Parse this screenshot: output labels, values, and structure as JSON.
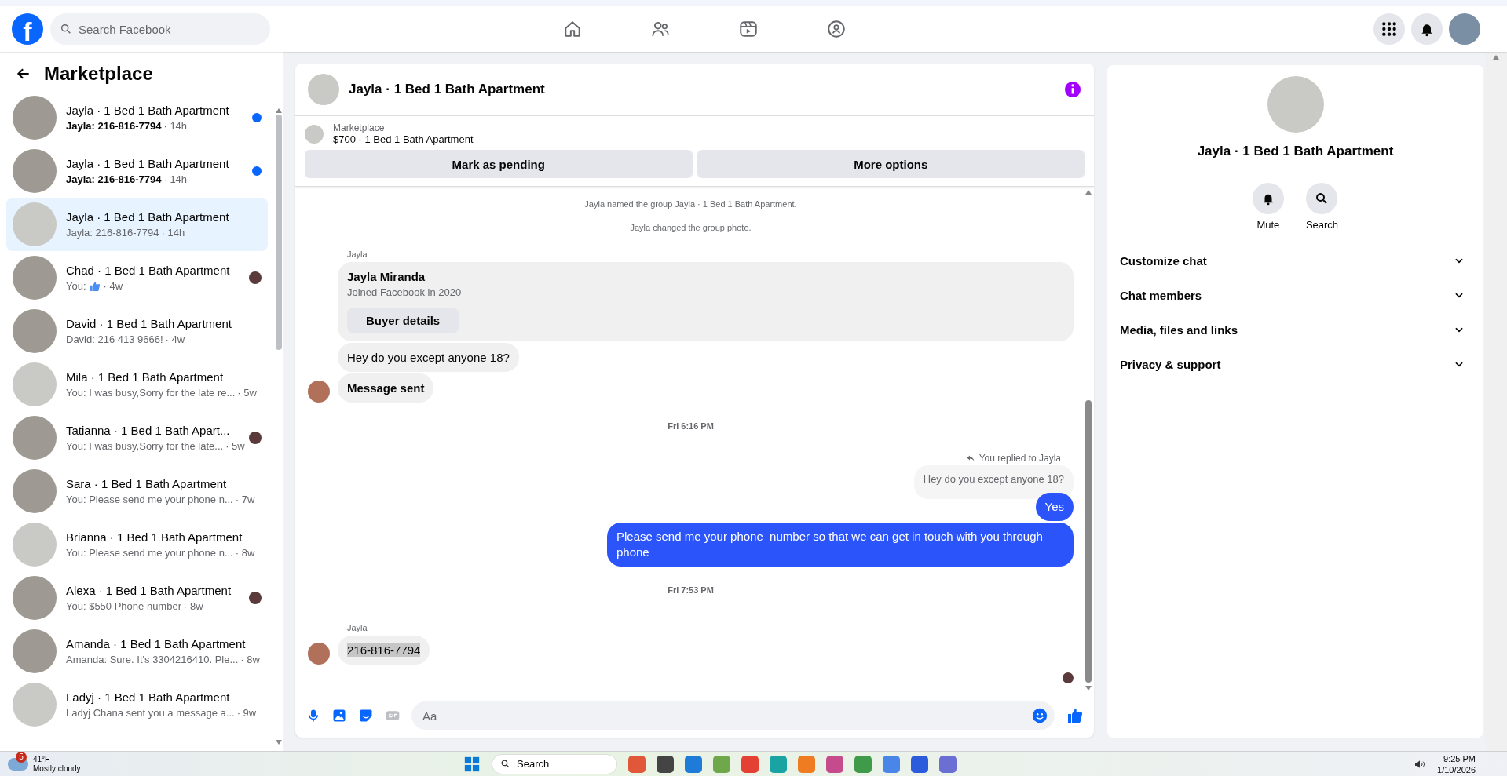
{
  "topbar": {
    "logo": "f",
    "search": {
      "placeholder": "Search Facebook"
    },
    "nav": [
      {
        "selected": false
      },
      {
        "selected": false
      },
      {
        "selected": false
      },
      {
        "selected": false
      }
    ]
  },
  "sidebar": {
    "title": "Marketplace",
    "conversations": [
      {
        "title": "Jayla · 1 Bed 1 Bath Apartment",
        "preview": "Jayla: 216-816-7794",
        "time": "· 14h",
        "unread": true,
        "seen_by": false,
        "selected": false
      },
      {
        "title": "Jayla · 1 Bed 1 Bath Apartment",
        "preview": "Jayla: 216-816-7794",
        "time": "· 14h",
        "unread": true,
        "seen_by": false,
        "selected": false
      },
      {
        "title": "Jayla · 1 Bed 1 Bath Apartment",
        "preview": "Jayla: 216-816-7794",
        "time": "· 14h",
        "unread": false,
        "seen_by": false,
        "selected": true
      },
      {
        "title": "Chad · 1 Bed 1 Bath Apartment",
        "preview": "You:",
        "kind": "like",
        "time": "· 4w",
        "unread": false,
        "seen_by": true,
        "selected": false
      },
      {
        "title": "David · 1 Bed 1 Bath Apartment",
        "preview": "David: 216 413 9666!",
        "time": "· 4w",
        "unread": false,
        "seen_by": false,
        "selected": false
      },
      {
        "title": "Mila · 1 Bed 1 Bath Apartment",
        "preview": "You: I was busy,Sorry for the late re...",
        "time": "· 5w",
        "unread": false,
        "seen_by": false,
        "selected": false
      },
      {
        "title": "Tatianna · 1 Bed 1 Bath Apart...",
        "preview": "You: I was busy,Sorry for the late...",
        "time": "· 5w",
        "unread": false,
        "seen_by": true,
        "selected": false
      },
      {
        "title": "Sara · 1 Bed 1 Bath Apartment",
        "preview": "You: Please send me your phone n...",
        "time": "· 7w",
        "unread": false,
        "seen_by": false,
        "selected": false
      },
      {
        "title": "Brianna · 1 Bed 1 Bath Apartment",
        "preview": "You: Please send me your phone n...",
        "time": "· 8w",
        "unread": false,
        "seen_by": false,
        "selected": false
      },
      {
        "title": "Alexa · 1 Bed 1 Bath Apartment",
        "preview": "You: $550 Phone number",
        "time": "· 8w",
        "unread": false,
        "seen_by": true,
        "selected": false
      },
      {
        "title": "Amanda · 1 Bed 1 Bath Apartment",
        "preview": "Amanda: Sure. It's 3304216410. Ple...",
        "time": "· 8w",
        "unread": false,
        "seen_by": false,
        "selected": false
      },
      {
        "title": "Ladyj · 1 Bed 1 Bath Apartment",
        "preview": "Ladyj Chana sent you a message a...",
        "time": "· 9w",
        "unread": false,
        "seen_by": false,
        "selected": false
      }
    ]
  },
  "chat": {
    "title": "Jayla · 1 Bed 1 Bath Apartment",
    "listing": {
      "label": "Marketplace",
      "name": "$700 - 1 Bed 1 Bath Apartment"
    },
    "actions": [
      "Mark as pending",
      "More options"
    ],
    "messages": [
      {
        "kind": "system",
        "text": "Jayla named the group Jayla · 1 Bed 1 Bath Apartment."
      },
      {
        "kind": "system",
        "text": "Jayla changed the group photo."
      },
      {
        "kind": "sender",
        "text": "Jayla"
      },
      {
        "kind": "card",
        "name": "Jayla Miranda",
        "text": "Joined Facebook in 2020",
        "button": "Buyer details"
      },
      {
        "kind": "incoming",
        "text": "Hey do you except anyone 18?",
        "avatar": false,
        "bold": false,
        "highlighted": false
      },
      {
        "kind": "incoming",
        "text": "Message sent",
        "avatar": true,
        "bold": true,
        "highlighted": false
      },
      {
        "kind": "timestamp",
        "text": "Fri 6:16 PM"
      },
      {
        "kind": "reply_note",
        "text": "You replied to Jayla"
      },
      {
        "kind": "quoted",
        "text": "Hey do you except anyone 18?"
      },
      {
        "kind": "outgoing",
        "text": "Yes"
      },
      {
        "kind": "outgoing",
        "text": "Please send me your phone  number so that we can get in touch with you through phone"
      },
      {
        "kind": "timestamp",
        "text": "Fri 7:53 PM"
      },
      {
        "kind": "sender",
        "text": "Jayla"
      },
      {
        "kind": "incoming",
        "text": "216-816-7794",
        "avatar": true,
        "bold": false,
        "highlighted": true
      },
      {
        "kind": "seen"
      }
    ],
    "composer": {
      "placeholder": "Aa"
    }
  },
  "details": {
    "title": "Jayla · 1 Bed 1 Bath Apartment",
    "actions": [
      {
        "label": "Mute"
      },
      {
        "label": "Search"
      }
    ],
    "sections": [
      {
        "label": "Customize chat",
        "expanded": false
      },
      {
        "label": "Chat members",
        "expanded": false
      },
      {
        "label": "Media, files and links",
        "expanded": false
      },
      {
        "label": "Privacy & support",
        "expanded": false
      }
    ]
  },
  "taskbar": {
    "weather": {
      "temp": "41°F",
      "condition": "Mostly cloudy",
      "badge": "5"
    },
    "search": "Search",
    "time": "9:25 PM",
    "date": "1/10/2026"
  }
}
